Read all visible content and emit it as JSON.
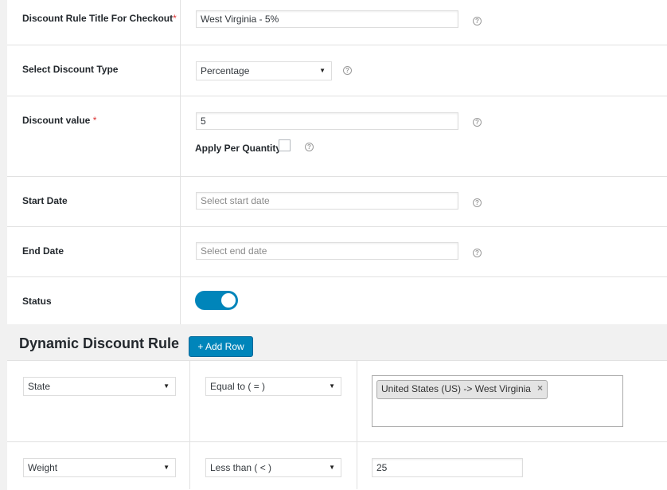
{
  "form": {
    "title_label": "Discount Rule Title For Checkout",
    "title_required": "*",
    "title_value": "West Virginia - 5%",
    "type_label": "Select Discount Type",
    "type_value": "Percentage",
    "value_label": "Discount value",
    "value_required": "*",
    "value_value": "5",
    "apply_per_quantity_label": "Apply Per Quantity",
    "apply_per_quantity_checked": false,
    "start_date_label": "Start Date",
    "start_date_placeholder": "Select start date",
    "end_date_label": "End Date",
    "end_date_placeholder": "Select end date",
    "status_label": "Status",
    "status_on": true,
    "help_glyph": "?"
  },
  "dynamic": {
    "title": "Dynamic Discount Rule",
    "add_row_label": "+ Add Row",
    "rows": [
      {
        "field": "State",
        "operator": "Equal to ( = )",
        "value_tag": "United States (US) -> West Virginia",
        "remove_glyph": "×"
      },
      {
        "field": "Weight",
        "operator": "Less than ( < )",
        "value": "25"
      }
    ]
  },
  "colors": {
    "accent": "#0085ba",
    "required": "#dc3232"
  }
}
